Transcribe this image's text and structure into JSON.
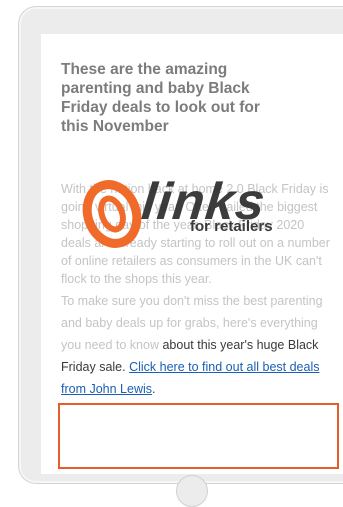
{
  "article": {
    "title": "These are the amazing parenting and baby Black Friday deals to look out for this November",
    "para1": "With the nation back at home 2.0 Black Friday is going virtual this year. Often hailed the biggest shopping day of the year, Black Friday 2020 deals are already starting to roll out on a number of online retailers as consumers in the UK can't flock to the shops this year.",
    "para2_faded": "To make sure you don't miss the best parenting and baby deals up for grabs, here's everything you need to know ",
    "para2_dark": "about this year's huge Black Friday sale. ",
    "link_text": "Click here to find out all best deals from John Lewis",
    "link_suffix": "."
  },
  "logo": {
    "word": "links",
    "tagline": "for retailers",
    "colors": {
      "ring": "#f06a2a",
      "text": "#2c2c2c"
    }
  },
  "colors": {
    "highlight_border": "#e55e28",
    "link": "#1a5fb4"
  }
}
